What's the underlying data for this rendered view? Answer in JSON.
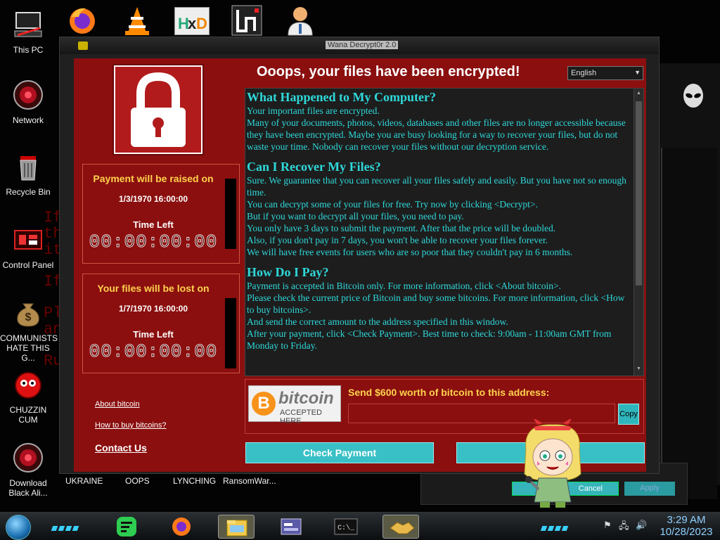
{
  "desktop": {
    "icons": [
      {
        "label": "This PC"
      },
      {
        "label": "Network"
      },
      {
        "label": "Recycle Bin"
      },
      {
        "label": "Control Panel"
      },
      {
        "label": "COMMUNISTS HATE THIS G..."
      },
      {
        "label": "CHUZZIN CUM"
      },
      {
        "label": "Download Black Ali..."
      }
    ],
    "bottom_labels": [
      "UKRAINE",
      "OOPS",
      "LYNCHING",
      "RansomWar..."
    ],
    "bg_code_lines": [
      "If",
      "th",
      "it",
      "If",
      "Pl",
      "an",
      "Ru"
    ]
  },
  "window": {
    "title": "Wana Decrypt0r 2.0",
    "headline": "Ooops, your files have been encrypted!",
    "language": "English",
    "timer1": {
      "heading": "Payment will be raised on",
      "date": "1/3/1970 16:00:00",
      "time_left_label": "Time Left",
      "countdown": "00:00:00:00"
    },
    "timer2": {
      "heading": "Your files will be lost on",
      "date": "1/7/1970 16:00:00",
      "time_left_label": "Time Left",
      "countdown": "00:00:00:00"
    },
    "links": {
      "about_bitcoin": "About bitcoin",
      "how_to_buy": "How to buy bitcoins?",
      "contact_us": "Contact Us"
    },
    "message": {
      "h1": "What Happened to My Computer?",
      "p1": "Your important files are encrypted.",
      "p2": "Many of your documents, photos, videos, databases and other files are no longer accessible because they have been encrypted. Maybe you are busy looking for a way to recover your files, but do not waste your time. Nobody can recover your files without our decryption service.",
      "h2": "Can I Recover My Files?",
      "p3": "Sure. We guarantee that you can recover all your files safely and easily. But you have not so enough time.",
      "p4": "You can decrypt some of your files for free. Try now by clicking <Decrypt>.",
      "p5": "But if you want to decrypt all your files, you need to pay.",
      "p6": "You only have 3 days to submit the payment. After that the price will be doubled.",
      "p7": "Also, if you don't pay in 7 days, you won't be able to recover your files forever.",
      "p8": "We will have free events for users who are so poor that they couldn't pay in 6 months.",
      "h3": "How Do I Pay?",
      "p9": "Payment is accepted in Bitcoin only. For more information, click <About bitcoin>.",
      "p10": "Please check the current price of Bitcoin and buy some bitcoins. For more information, click <How to buy bitcoins>.",
      "p11": "And send the correct amount to the address specified in this window.",
      "p12": "After your payment, click <Check Payment>. Best time to check: 9:00am - 11:00am GMT from Monday to Friday."
    },
    "bitcoin": {
      "logo_word": "bitcoin",
      "logo_sub": "ACCEPTED HERE",
      "send_label": "Send $600 worth of bitcoin to this address:",
      "address": "",
      "copy_label": "Copy"
    },
    "buttons": {
      "check_payment": "Check Payment",
      "decrypt": ""
    }
  },
  "background_dialog": {
    "cancel": "Cancel",
    "apply": "Apply"
  },
  "taskbar": {
    "time": "3:29 AM",
    "date": "10/28/2023"
  },
  "colors": {
    "panel_red": "#8b0f0f",
    "message_cyan": "#2fd8da",
    "heading_yellow": "#ffd34d",
    "button_cyan": "#39c0c6"
  }
}
